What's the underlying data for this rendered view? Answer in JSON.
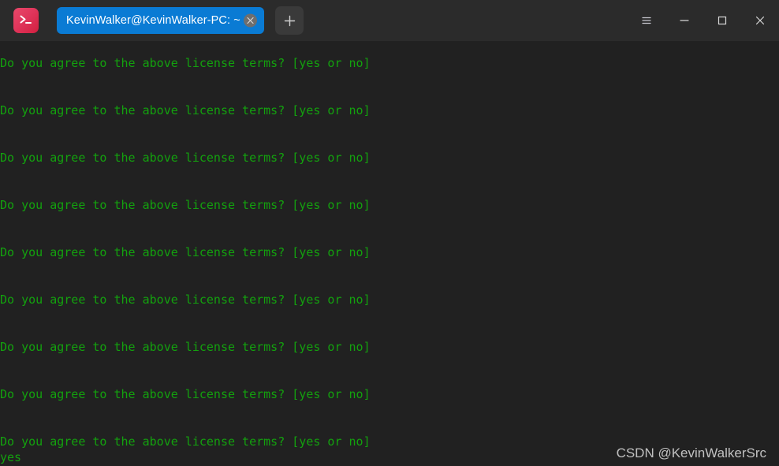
{
  "window": {
    "app_icon": "terminal-prompt-icon",
    "titlebar_color": "#2b2b2b",
    "controls": [
      {
        "name": "menu",
        "icon": "hamburger-menu-icon"
      },
      {
        "name": "minimize",
        "icon": "minimize-icon"
      },
      {
        "name": "maximize",
        "icon": "maximize-icon"
      },
      {
        "name": "close",
        "icon": "close-icon"
      }
    ]
  },
  "tabs": {
    "active_index": 0,
    "items": [
      {
        "title": "KevinWalker@KevinWalker-PC: ~",
        "close_icon": "close-icon",
        "color": "#0a7bd4"
      }
    ],
    "new_tab_label": "+",
    "new_tab_icon": "plus-icon"
  },
  "terminal": {
    "background": "#212121",
    "foreground": "#13a10e",
    "prompt_text": "Do you agree to the above license terms? [yes or no]",
    "answer_text": "yes",
    "lines": [
      "Do you agree to the above license terms? [yes or no]",
      "",
      "",
      "Do you agree to the above license terms? [yes or no]",
      "",
      "",
      "Do you agree to the above license terms? [yes or no]",
      "",
      "",
      "Do you agree to the above license terms? [yes or no]",
      "",
      "",
      "Do you agree to the above license terms? [yes or no]",
      "",
      "",
      "Do you agree to the above license terms? [yes or no]",
      "",
      "",
      "Do you agree to the above license terms? [yes or no]",
      "",
      "",
      "Do you agree to the above license terms? [yes or no]",
      "",
      "",
      "Do you agree to the above license terms? [yes or no]",
      "yes"
    ]
  },
  "watermark": {
    "text": "CSDN @KevinWalkerSrc"
  }
}
